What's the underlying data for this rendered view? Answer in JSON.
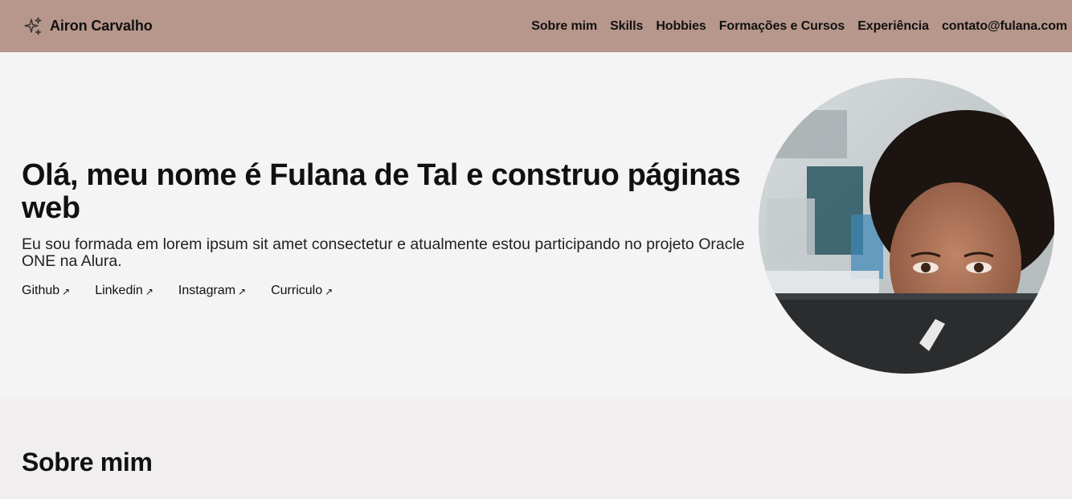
{
  "header": {
    "brand_name": "Airon Carvalho",
    "brand_icon": "sparkles-icon",
    "nav": [
      {
        "label": "Sobre mim"
      },
      {
        "label": "Skills"
      },
      {
        "label": "Hobbies"
      },
      {
        "label": "Formações e Cursos"
      },
      {
        "label": "Experiência"
      },
      {
        "label": "contato@fulana.com"
      }
    ]
  },
  "hero": {
    "title": "Olá, meu nome é Fulana de Tal e construo páginas web",
    "subtitle": "Eu sou formada em lorem ipsum sit amet consectetur e atualmente estou participando no projeto Oracle ONE na Alura.",
    "links": [
      {
        "label": "Github",
        "icon": "arrow-up-right-icon"
      },
      {
        "label": "Linkedin",
        "icon": "arrow-up-right-icon"
      },
      {
        "label": "Instagram",
        "icon": "arrow-up-right-icon"
      },
      {
        "label": "Curriculo",
        "icon": "arrow-up-right-icon"
      }
    ],
    "avatar": "profile-photo"
  },
  "about": {
    "title": "Sobre mim"
  },
  "colors": {
    "header_bg": "#b7978b",
    "hero_bg": "#f4f4f4",
    "section_bg": "#f0eeee",
    "text": "#111111"
  }
}
